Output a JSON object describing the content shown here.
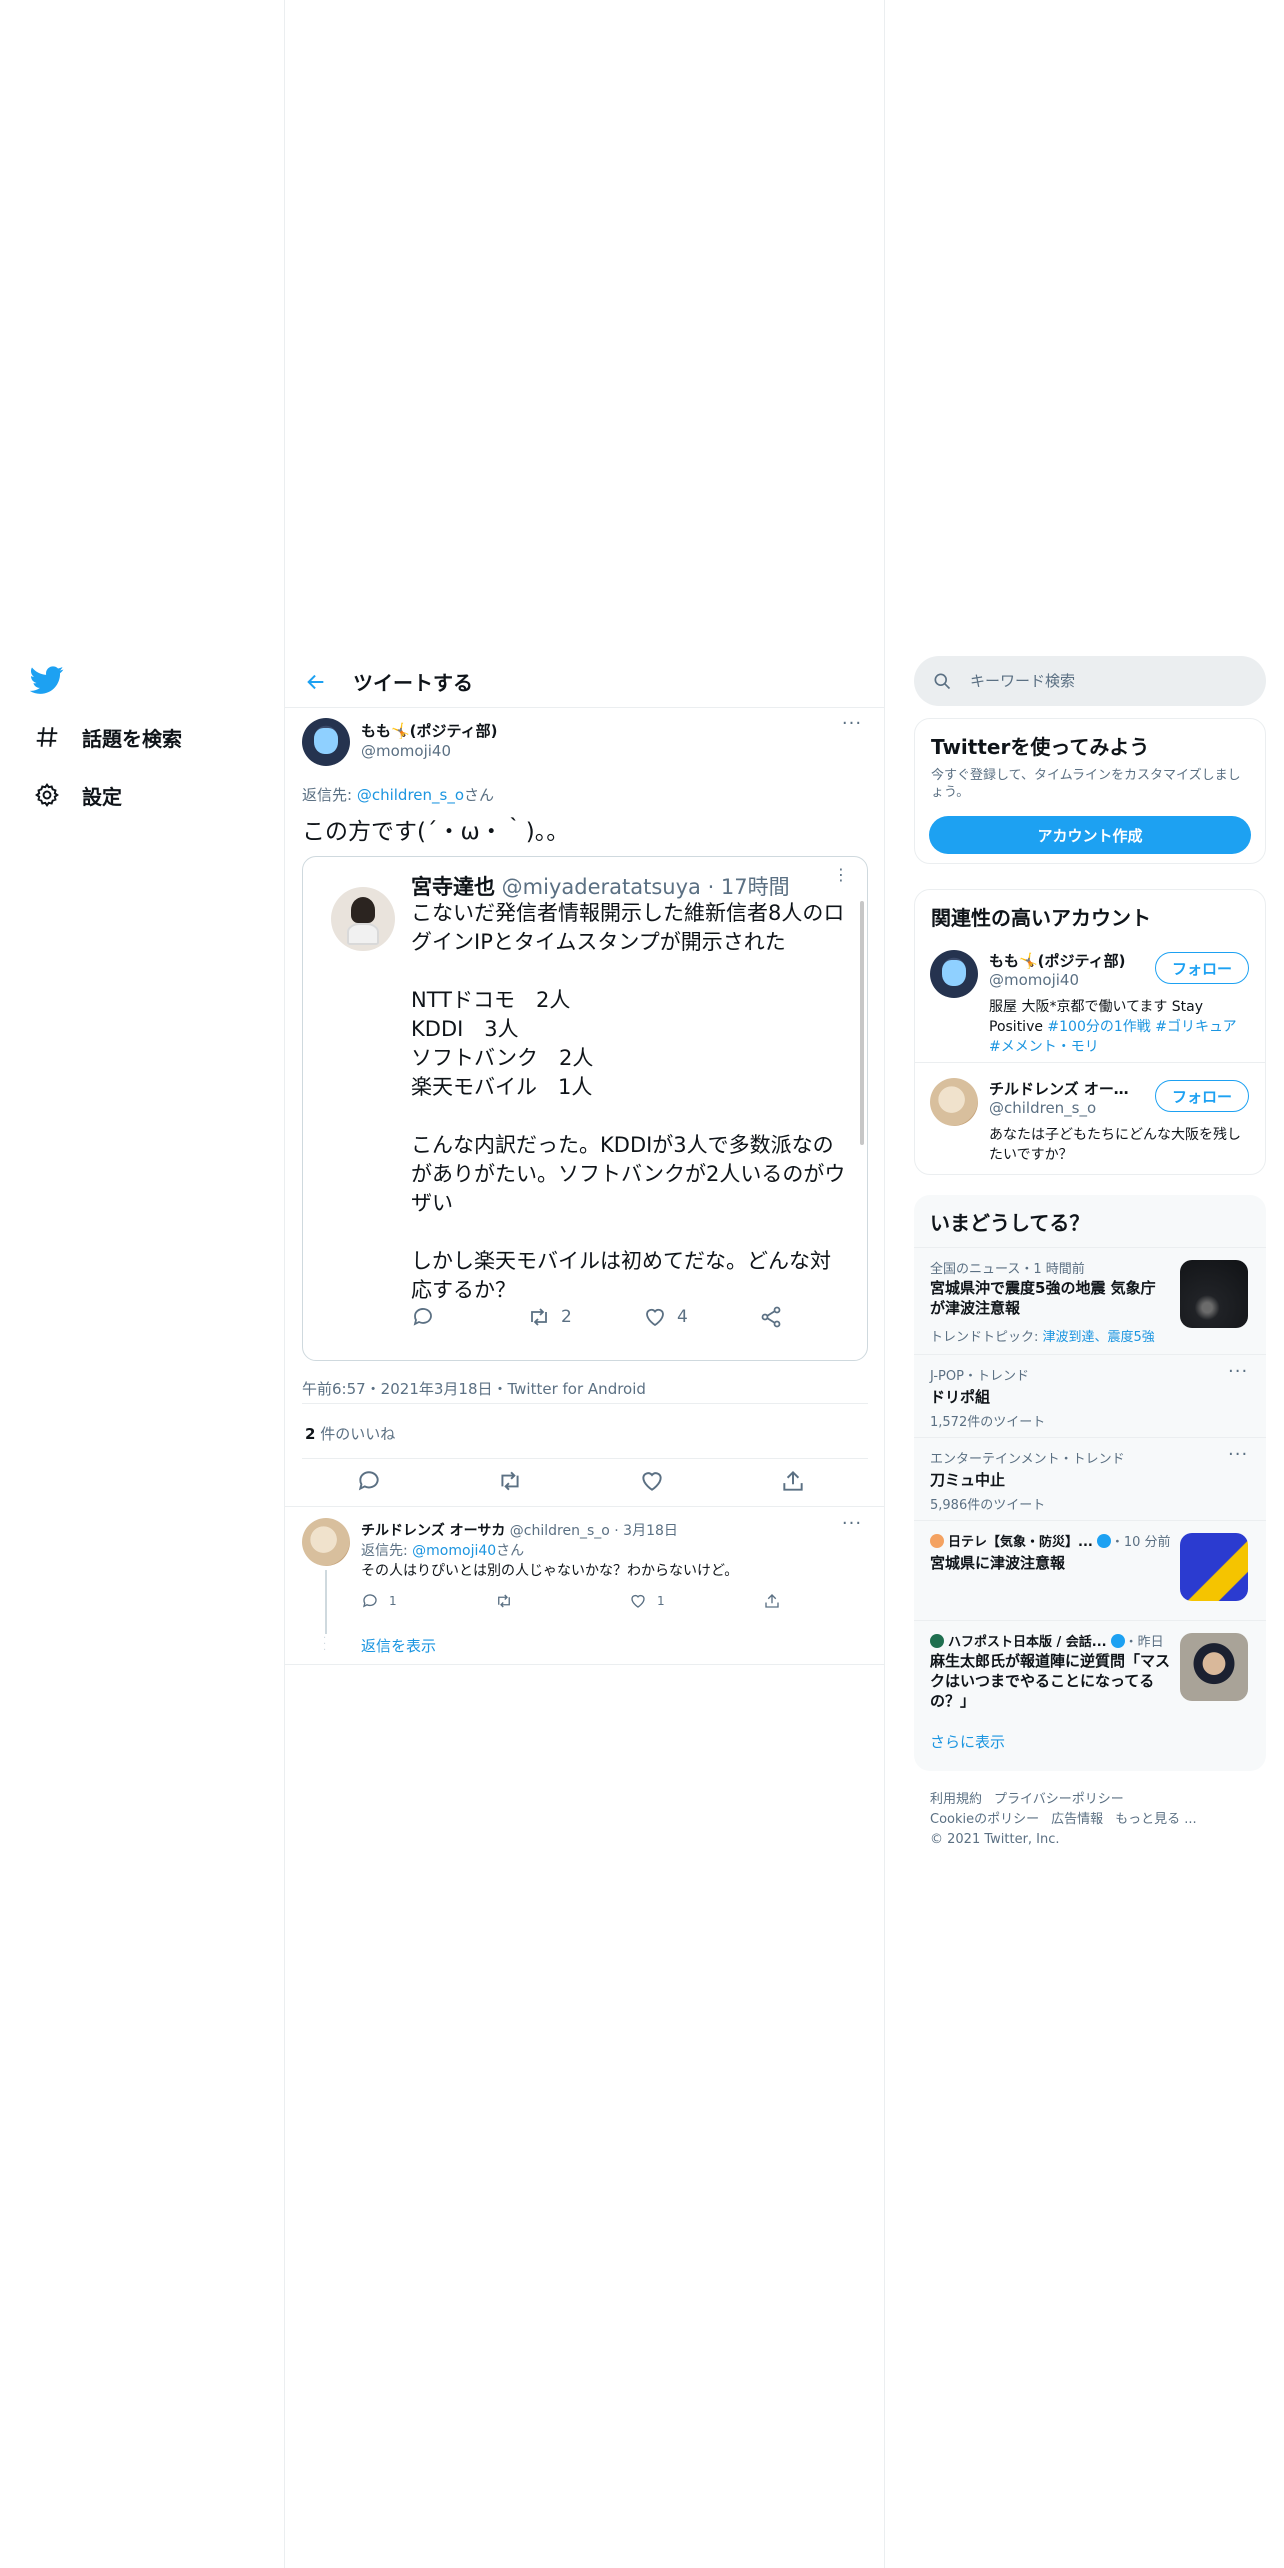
{
  "nav": {
    "items": [
      {
        "label": "話題を検索",
        "icon": "hashtag-icon"
      },
      {
        "label": "設定",
        "icon": "gear-icon"
      }
    ]
  },
  "header": {
    "title": "ツイートする"
  },
  "tweet": {
    "name": "もも🤸(ポジティ部)",
    "handle": "@momoji40",
    "reply_prefix": "返信先: ",
    "reply_to": "@children_s_o",
    "reply_suffix": "さん",
    "text": "この方です(´・ω・｀)。。",
    "meta": "午前6:57・2021年3月18日・Twitter for Android",
    "likes_count": "2",
    "likes_label": " 件のいいね"
  },
  "embed": {
    "name": "宮寺達也",
    "handle": " @miyaderatatsuya · 17時間",
    "text": "こないだ発信者情報開示した維新信者8人のログインIPとタイムスタンプが開示された\n\nNTTドコモ　2人\nKDDI　3人\nソフトバンク　2人\n楽天モバイル　1人\n\nこんな内訳だった。KDDIが3人で多数派なのがありがたい。ソフトバンクが2人いるのがウザい\n\nしかし楽天モバイルは初めてだな。どんな対応するか？",
    "retweets": "2",
    "likes": "4"
  },
  "reply": {
    "name": "チルドレンズ オーサカ",
    "handle": " @children_s_o · 3月18日",
    "reply_prefix": "返信先: ",
    "reply_to": "@momoji40",
    "reply_suffix": "さん",
    "text": "その人はりぴいとは別の人じゃないかな？わからないけど。",
    "replies": "1",
    "likes": "1",
    "show_replies": "返信を表示"
  },
  "search": {
    "placeholder": "キーワード検索"
  },
  "signup": {
    "title": "Twitterを使ってみよう",
    "desc": "今すぐ登録して、タイムラインをカスタマイズしましょう。",
    "button": "アカウント作成"
  },
  "related": {
    "title": "関連性の高いアカウント",
    "follow": "フォロー",
    "accounts": [
      {
        "name": "もも🤸(ポジティ部)",
        "handle": "@momoji40",
        "bio_text": "服屋 大阪*京都で働いてます Stay Positive ",
        "bio_tags": "#100分の1作戦 #ゴリキュア #メメント・モリ"
      },
      {
        "name": "チルドレンズ オーサカ",
        "handle": "@children_s_o",
        "bio_text": "あなたは子どもたちにどんな大阪を残したいですか？",
        "bio_tags": ""
      }
    ]
  },
  "trends": {
    "title": "いまどうしてる？",
    "items": [
      {
        "category": "全国のニュース・1 時間前",
        "title": "宮城県沖で震度5強の地震 気象庁が津波注意報",
        "sub_prefix": "トレンドトピック: ",
        "sub_links": "津波到達、震度5強"
      },
      {
        "category": "J-POP・トレンド",
        "title": "ドリポ組",
        "sub": "1,572件のツイート"
      },
      {
        "category": "エンターテインメント・トレンド",
        "title": "刀ミュ中止",
        "sub": "5,986件のツイート"
      },
      {
        "category": "日テレ【気象・防災】...",
        "time": "・10 分前",
        "title": "宮城県に津波注意報"
      },
      {
        "category": "ハフポスト日本版 / 会話...",
        "time": "・昨日",
        "title": "麻生太郎氏が報道陣に逆質問「マスクはいつまでやることになってるの？」"
      }
    ],
    "show_more": "さらに表示"
  },
  "footer": {
    "links": [
      "利用規約",
      "プライバシーポリシー",
      "Cookieのポリシー",
      "広告情報",
      "もっと見る ..."
    ],
    "copyright": "© 2021 Twitter, Inc."
  },
  "colors": {
    "accent": "#1da1f2",
    "link": "#1b95e0",
    "secondary_text": "#5b7083"
  }
}
